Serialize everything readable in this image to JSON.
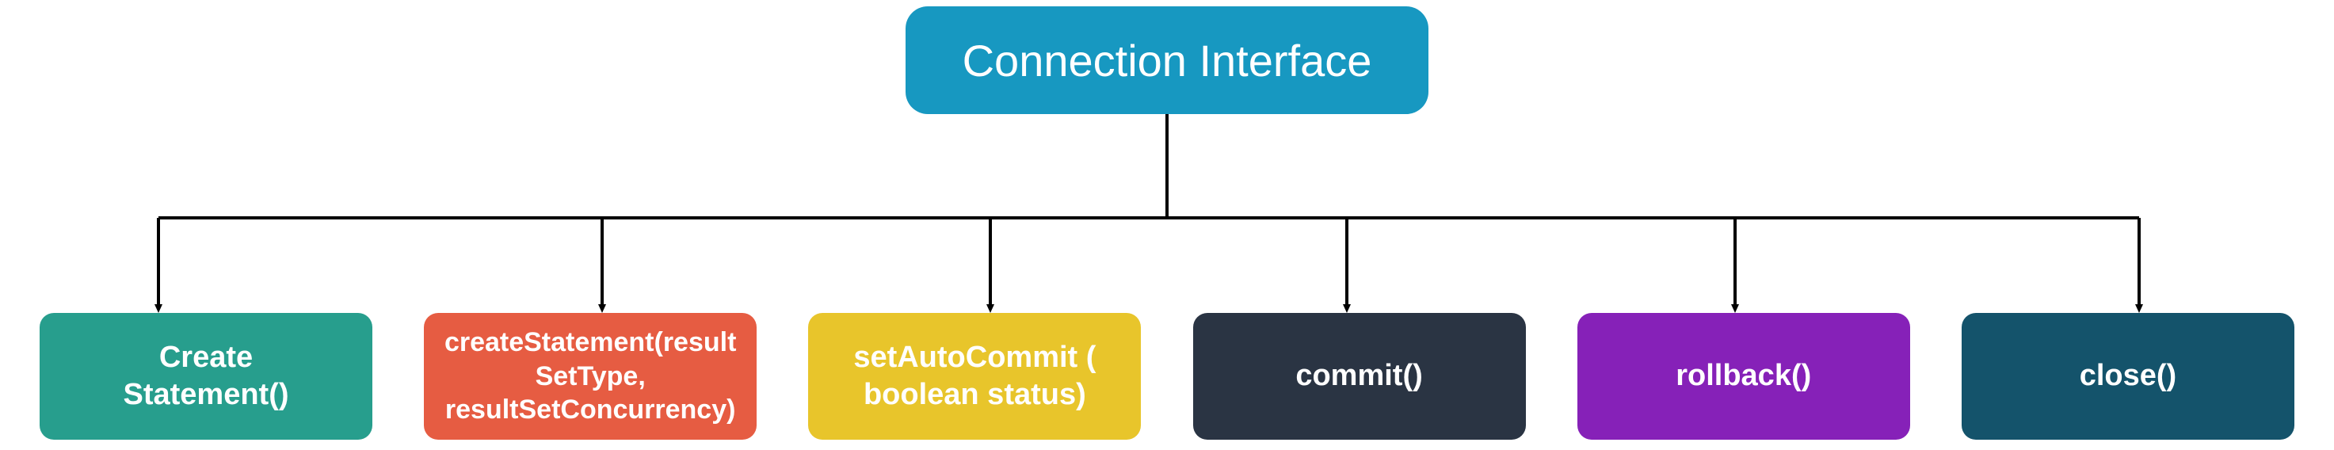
{
  "diagram": {
    "root": {
      "label": "Connection Interface"
    },
    "children": [
      {
        "label": "Create\nStatement()",
        "color": "#279e8d"
      },
      {
        "label": "createStatement(result\nSetType,\nresultSetConcurrency)",
        "color": "#e65c42"
      },
      {
        "label": "setAutoCommit (\nboolean status)",
        "color": "#e8c52b"
      },
      {
        "label": "commit()",
        "color": "#2a3443"
      },
      {
        "label": "rollback()",
        "color": "#8621b8"
      },
      {
        "label": "close()",
        "color": "#14536b"
      }
    ]
  }
}
